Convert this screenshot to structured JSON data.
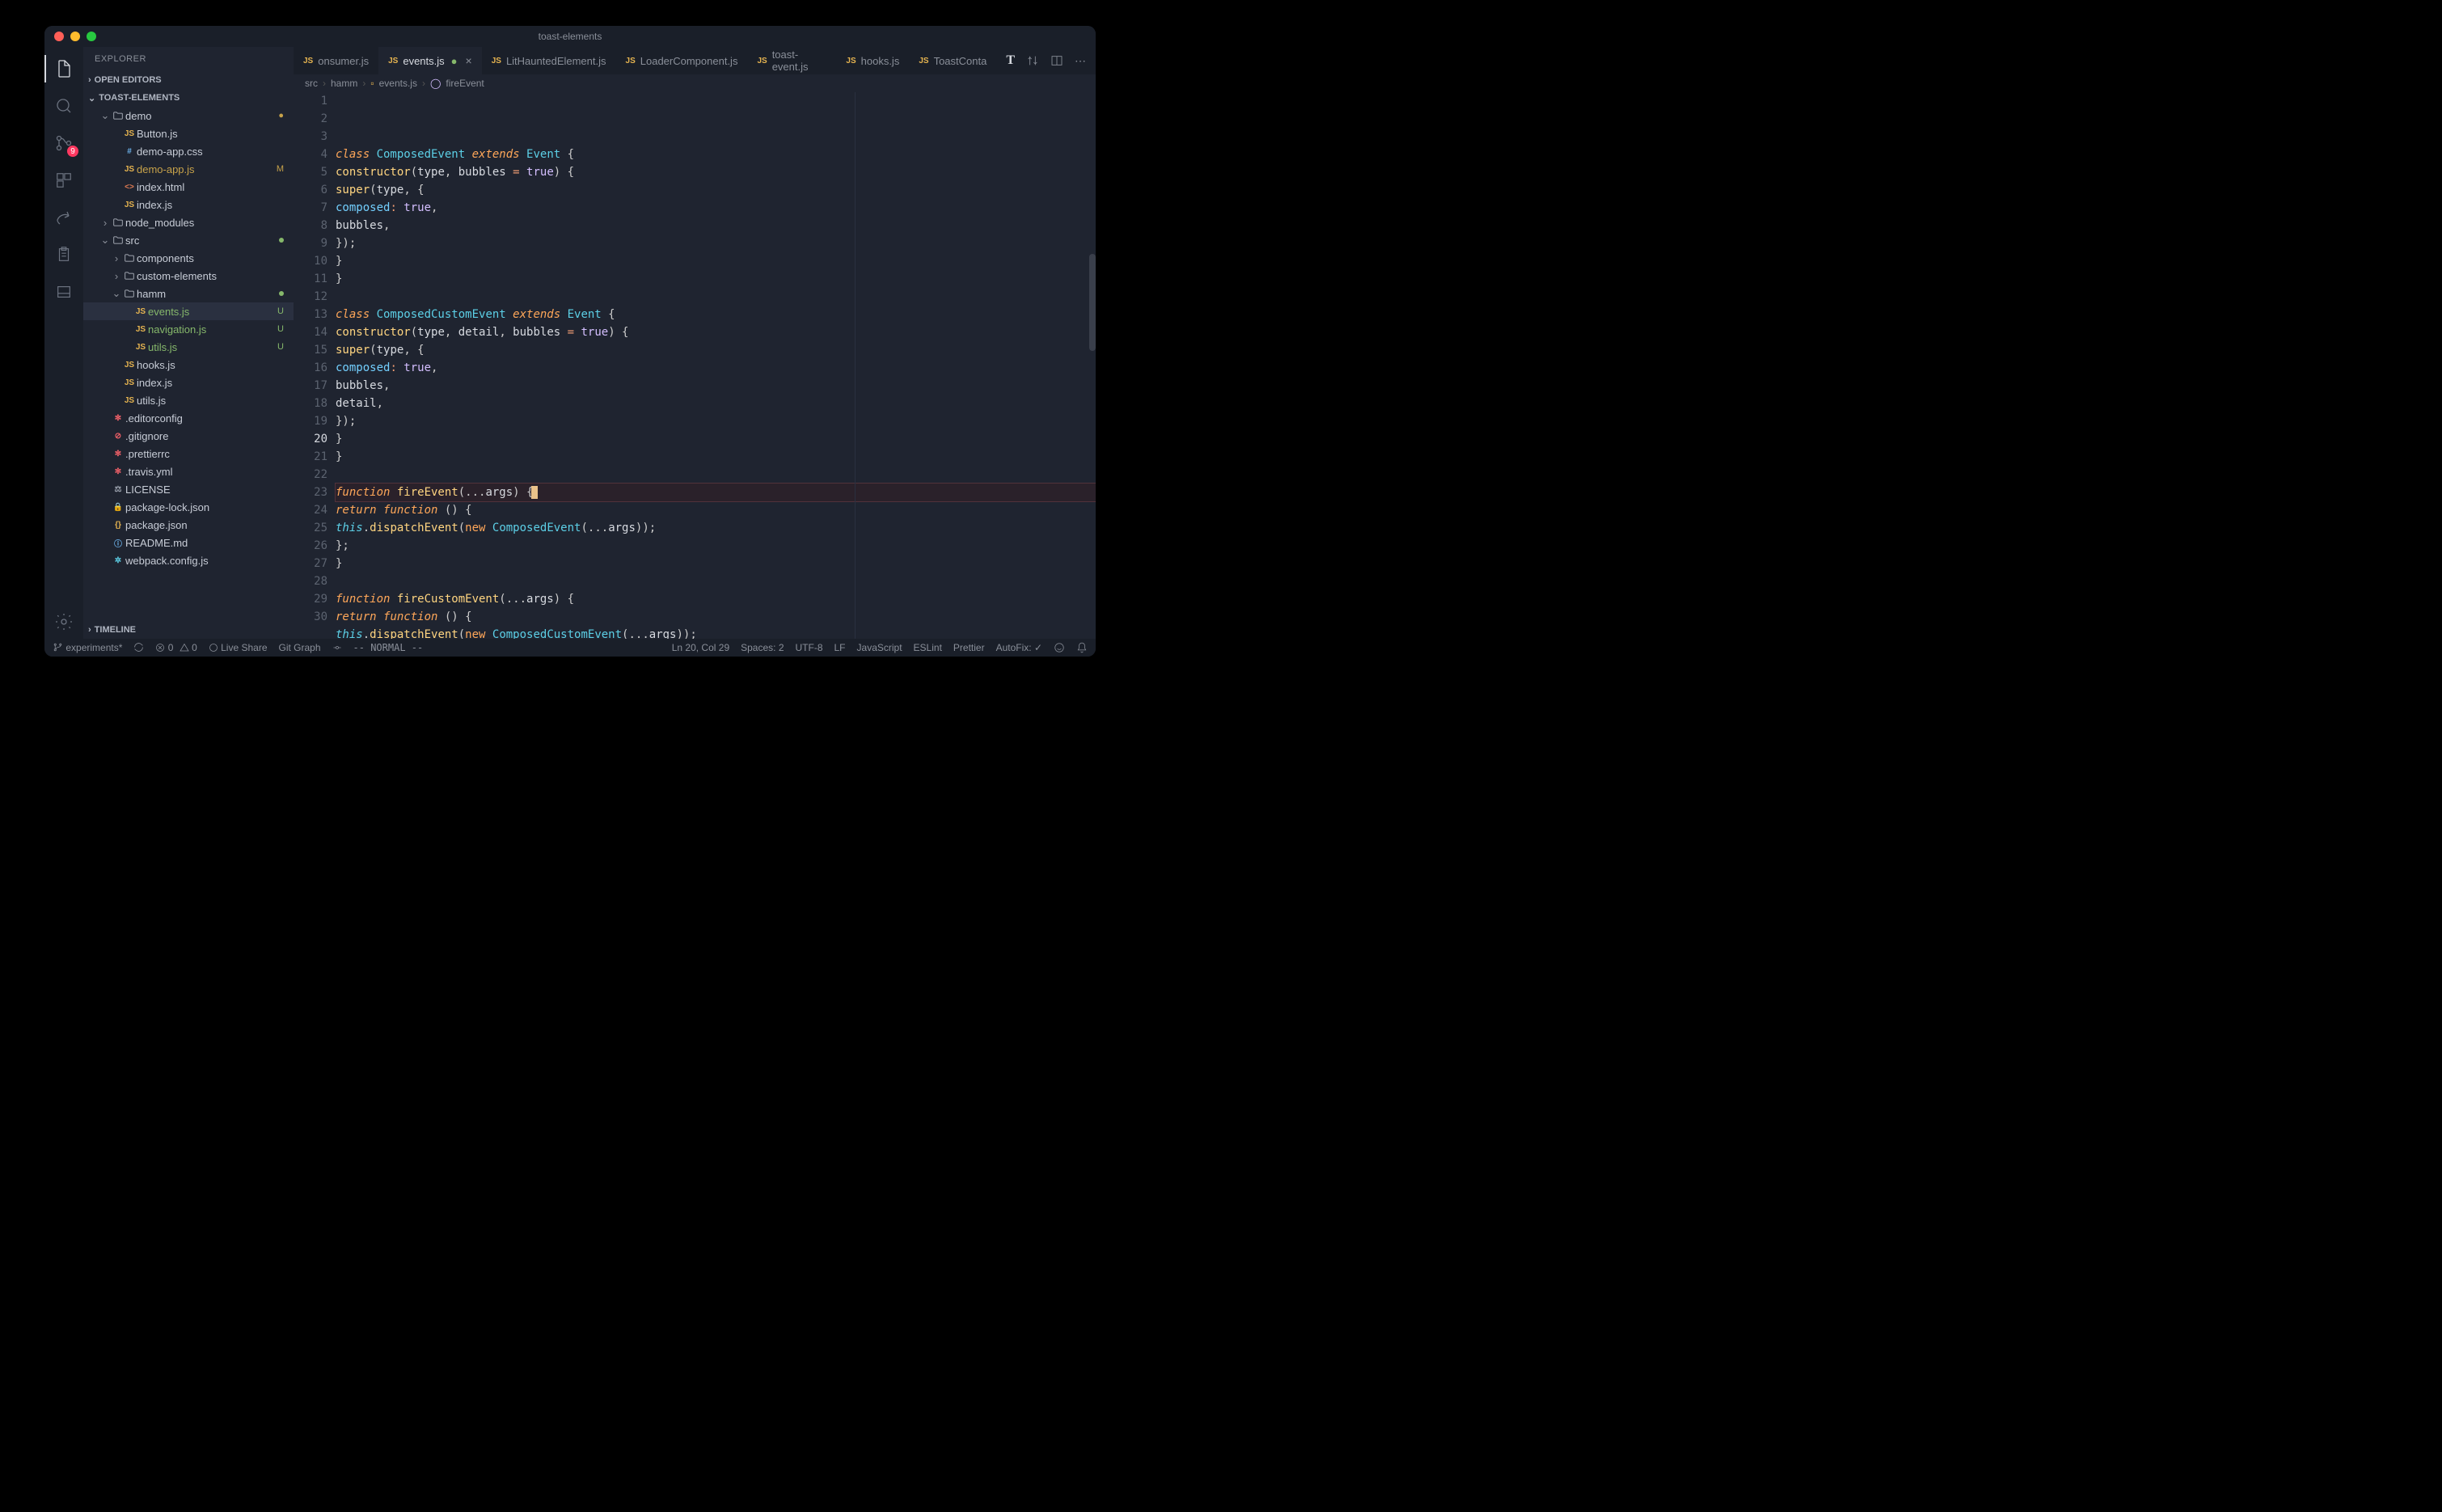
{
  "window_title": "toast-elements",
  "explorer": {
    "title": "EXPLORER",
    "sections": {
      "open_editors": "OPEN EDITORS",
      "project": "TOAST-ELEMENTS",
      "timeline": "TIMELINE"
    },
    "tree": [
      {
        "depth": 1,
        "kind": "folder",
        "label": "demo",
        "open": true,
        "status": "dot"
      },
      {
        "depth": 2,
        "kind": "js",
        "label": "Button.js"
      },
      {
        "depth": 2,
        "kind": "css",
        "label": "demo-app.css"
      },
      {
        "depth": 2,
        "kind": "js",
        "label": "demo-app.js",
        "status": "M"
      },
      {
        "depth": 2,
        "kind": "html",
        "label": "index.html"
      },
      {
        "depth": 2,
        "kind": "js",
        "label": "index.js"
      },
      {
        "depth": 1,
        "kind": "folder",
        "label": "node_modules",
        "open": false
      },
      {
        "depth": 1,
        "kind": "folder",
        "label": "src",
        "open": true,
        "status": "gdot"
      },
      {
        "depth": 2,
        "kind": "folder",
        "label": "components",
        "open": false
      },
      {
        "depth": 2,
        "kind": "folder",
        "label": "custom-elements",
        "open": false
      },
      {
        "depth": 2,
        "kind": "folder",
        "label": "hamm",
        "open": true,
        "status": "gdot"
      },
      {
        "depth": 3,
        "kind": "js",
        "label": "events.js",
        "status": "U",
        "selected": true
      },
      {
        "depth": 3,
        "kind": "js",
        "label": "navigation.js",
        "status": "U"
      },
      {
        "depth": 3,
        "kind": "js",
        "label": "utils.js",
        "status": "U"
      },
      {
        "depth": 2,
        "kind": "js",
        "label": "hooks.js"
      },
      {
        "depth": 2,
        "kind": "js",
        "label": "index.js"
      },
      {
        "depth": 2,
        "kind": "js",
        "label": "utils.js"
      },
      {
        "depth": 1,
        "kind": "gear",
        "label": ".editorconfig"
      },
      {
        "depth": 1,
        "kind": "noentry",
        "label": ".gitignore"
      },
      {
        "depth": 1,
        "kind": "gear",
        "label": ".prettierrc"
      },
      {
        "depth": 1,
        "kind": "gear",
        "label": ".travis.yml"
      },
      {
        "depth": 1,
        "kind": "scale",
        "label": "LICENSE"
      },
      {
        "depth": 1,
        "kind": "lock",
        "label": "package-lock.json"
      },
      {
        "depth": 1,
        "kind": "json",
        "label": "package.json"
      },
      {
        "depth": 1,
        "kind": "md",
        "label": "README.md"
      },
      {
        "depth": 1,
        "kind": "webpack",
        "label": "webpack.config.js"
      }
    ]
  },
  "source_control_badge": "9",
  "tabs": [
    {
      "label": "onsumer.js",
      "icon": "js"
    },
    {
      "label": "events.js",
      "icon": "js",
      "active": true,
      "close": true,
      "status": "U"
    },
    {
      "label": "LitHauntedElement.js",
      "icon": "js"
    },
    {
      "label": "LoaderComponent.js",
      "icon": "js"
    },
    {
      "label": "toast-event.js",
      "icon": "js"
    },
    {
      "label": "hooks.js",
      "icon": "js"
    },
    {
      "label": "ToastConta",
      "icon": "js",
      "truncated": true
    }
  ],
  "breadcrumb": [
    "src",
    "hamm",
    "events.js",
    "fireEvent"
  ],
  "code": {
    "start": 1,
    "highlight": 20,
    "lines": [
      [
        [
          "kw",
          "class "
        ],
        [
          "cls",
          "ComposedEvent "
        ],
        [
          "kw",
          "extends "
        ],
        [
          "cls",
          "Event "
        ],
        [
          "punct",
          "{"
        ]
      ],
      [
        [
          "pad",
          "  "
        ],
        [
          "fn",
          "constructor"
        ],
        [
          "punct",
          "("
        ],
        [
          "param",
          "type"
        ],
        [
          "punct",
          ", "
        ],
        [
          "param",
          "bubbles"
        ],
        [
          "op",
          " = "
        ],
        [
          "bool",
          "true"
        ],
        [
          "punct",
          ") {"
        ]
      ],
      [
        [
          "pad",
          "    "
        ],
        [
          "fn",
          "super"
        ],
        [
          "punct",
          "("
        ],
        [
          "param",
          "type"
        ],
        [
          "punct",
          ", {"
        ]
      ],
      [
        [
          "pad",
          "      "
        ],
        [
          "prop",
          "composed"
        ],
        [
          "op",
          ": "
        ],
        [
          "bool",
          "true"
        ],
        [
          "punct",
          ","
        ]
      ],
      [
        [
          "pad",
          "      "
        ],
        [
          "param",
          "bubbles"
        ],
        [
          "punct",
          ","
        ]
      ],
      [
        [
          "pad",
          "    "
        ],
        [
          "punct",
          "});"
        ]
      ],
      [
        [
          "pad",
          "  "
        ],
        [
          "punct",
          "}"
        ]
      ],
      [
        [
          "punct",
          "}"
        ]
      ],
      [],
      [
        [
          "kw",
          "class "
        ],
        [
          "cls",
          "ComposedCustomEvent "
        ],
        [
          "kw",
          "extends "
        ],
        [
          "cls",
          "Event "
        ],
        [
          "punct",
          "{"
        ]
      ],
      [
        [
          "pad",
          "  "
        ],
        [
          "fn",
          "constructor"
        ],
        [
          "punct",
          "("
        ],
        [
          "param",
          "type"
        ],
        [
          "punct",
          ", "
        ],
        [
          "param",
          "detail"
        ],
        [
          "punct",
          ", "
        ],
        [
          "param",
          "bubbles"
        ],
        [
          "op",
          " = "
        ],
        [
          "bool",
          "true"
        ],
        [
          "punct",
          ") {"
        ]
      ],
      [
        [
          "pad",
          "    "
        ],
        [
          "fn",
          "super"
        ],
        [
          "punct",
          "("
        ],
        [
          "param",
          "type"
        ],
        [
          "punct",
          ", {"
        ]
      ],
      [
        [
          "pad",
          "      "
        ],
        [
          "prop",
          "composed"
        ],
        [
          "op",
          ": "
        ],
        [
          "bool",
          "true"
        ],
        [
          "punct",
          ","
        ]
      ],
      [
        [
          "pad",
          "      "
        ],
        [
          "param",
          "bubbles"
        ],
        [
          "punct",
          ","
        ]
      ],
      [
        [
          "pad",
          "      "
        ],
        [
          "param",
          "detail"
        ],
        [
          "punct",
          ","
        ]
      ],
      [
        [
          "pad",
          "    "
        ],
        [
          "punct",
          "});"
        ]
      ],
      [
        [
          "pad",
          "  "
        ],
        [
          "punct",
          "}"
        ]
      ],
      [
        [
          "punct",
          "}"
        ]
      ],
      [],
      [
        [
          "kw",
          "function "
        ],
        [
          "fn",
          "fireEvent"
        ],
        [
          "punct",
          "(..."
        ],
        [
          "param",
          "args"
        ],
        [
          "punct",
          ") "
        ],
        [
          "punct",
          "{"
        ],
        [
          "cursor",
          ""
        ]
      ],
      [
        [
          "pad",
          "  "
        ],
        [
          "kw",
          "return "
        ],
        [
          "kw",
          "function "
        ],
        [
          "punct",
          "() {"
        ]
      ],
      [
        [
          "pad",
          "    "
        ],
        [
          "this",
          "this"
        ],
        [
          "punct",
          "."
        ],
        [
          "fn",
          "dispatchEvent"
        ],
        [
          "punct",
          "("
        ],
        [
          "kw2",
          "new "
        ],
        [
          "cls",
          "ComposedEvent"
        ],
        [
          "punct",
          "(..."
        ],
        [
          "param",
          "args"
        ],
        [
          "punct",
          "));"
        ]
      ],
      [
        [
          "pad",
          "  "
        ],
        [
          "punct",
          "};"
        ]
      ],
      [
        [
          "punct",
          "}"
        ]
      ],
      [],
      [
        [
          "kw",
          "function "
        ],
        [
          "fn",
          "fireCustomEvent"
        ],
        [
          "punct",
          "(..."
        ],
        [
          "param",
          "args"
        ],
        [
          "punct",
          ") {"
        ]
      ],
      [
        [
          "pad",
          "  "
        ],
        [
          "kw",
          "return "
        ],
        [
          "kw",
          "function "
        ],
        [
          "punct",
          "() {"
        ]
      ],
      [
        [
          "pad",
          "    "
        ],
        [
          "this",
          "this"
        ],
        [
          "punct",
          "."
        ],
        [
          "fn",
          "dispatchEvent"
        ],
        [
          "punct",
          "("
        ],
        [
          "kw2",
          "new "
        ],
        [
          "cls",
          "ComposedCustomEvent"
        ],
        [
          "punct",
          "(..."
        ],
        [
          "param",
          "args"
        ],
        [
          "punct",
          "));"
        ]
      ],
      [
        [
          "pad",
          "  "
        ],
        [
          "punct",
          "};"
        ]
      ],
      [
        [
          "punct",
          "}"
        ]
      ]
    ]
  },
  "statusbar": {
    "branch": "experiments*",
    "sync": "",
    "errors": "0",
    "warnings": "0",
    "liveshare": "Live Share",
    "gitgraph": "Git Graph",
    "vim": "-- NORMAL --",
    "position": "Ln 20, Col 29",
    "spaces": "Spaces: 2",
    "encoding": "UTF-8",
    "eol": "LF",
    "language": "JavaScript",
    "eslint": "ESLint",
    "prettier": "Prettier",
    "autofix": "AutoFix: ✓"
  }
}
